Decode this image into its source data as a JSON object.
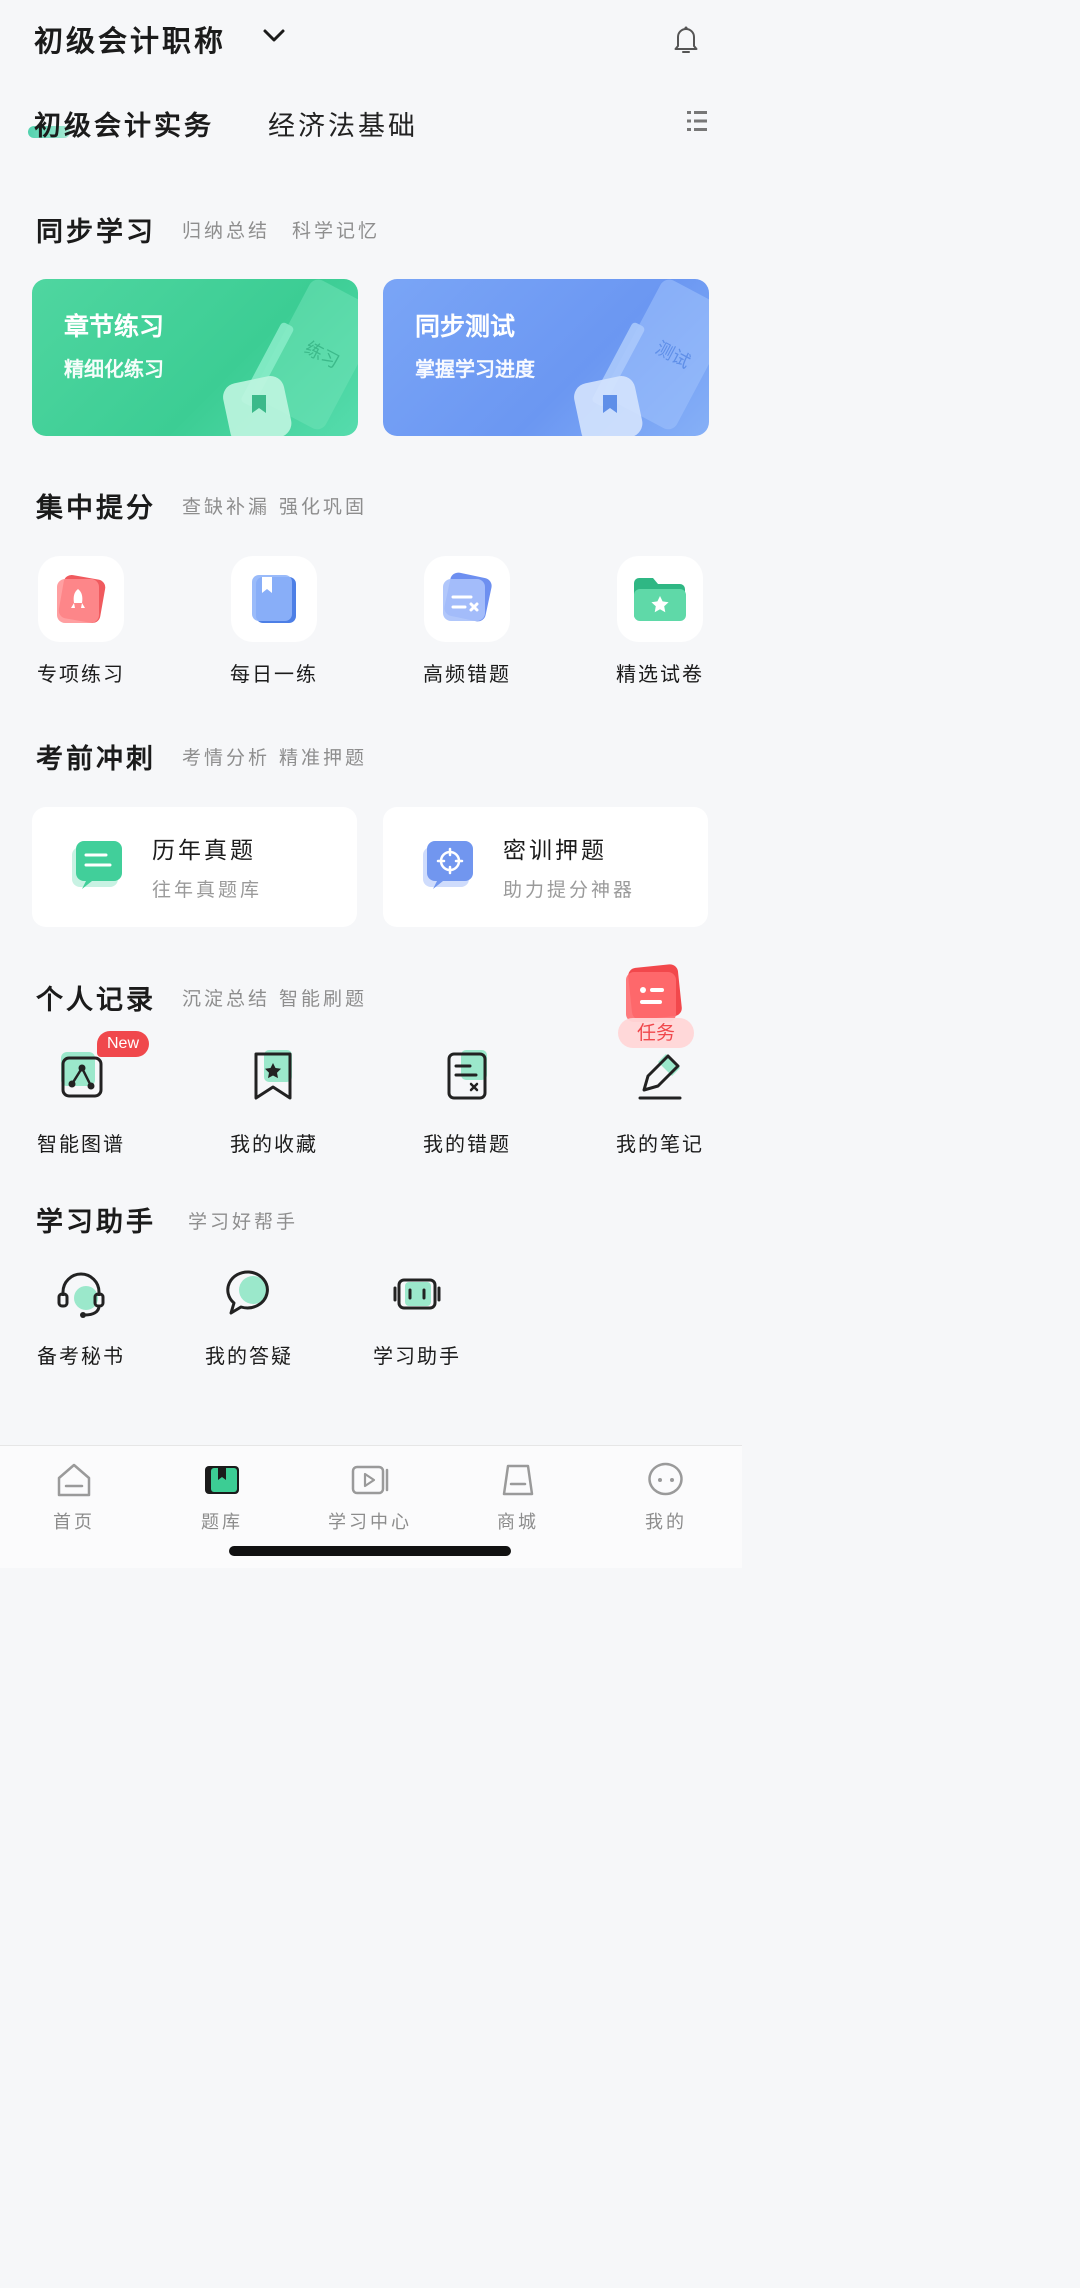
{
  "header": {
    "exam_title": "初级会计职称",
    "chevron_icon": "chevron-down-icon",
    "bell_icon": "bell-icon"
  },
  "subject_tabs": [
    {
      "label": "初级会计实务",
      "active": true
    },
    {
      "label": "经济法基础",
      "active": false
    }
  ],
  "sections": {
    "sync": {
      "title": "同步学习",
      "subtitle": "归纳总结　科学记忆"
    },
    "focus": {
      "title": "集中提分",
      "subtitle": "查缺补漏 强化巩固"
    },
    "sprint": {
      "title": "考前冲刺",
      "subtitle": "考情分析 精准押题"
    },
    "records": {
      "title": "个人记录",
      "subtitle": "沉淀总结 智能刷题"
    },
    "assistant": {
      "title": "学习助手",
      "subtitle": "学习好帮手"
    }
  },
  "sync_cards": [
    {
      "title": "章节练习",
      "subtitle": "精细化练习",
      "color": "#3ccd94"
    },
    {
      "title": "同步测试",
      "subtitle": "掌握学习进度",
      "color": "#6b97f2"
    }
  ],
  "focus_items": [
    {
      "label": "专项练习",
      "icon": "rocket-icon"
    },
    {
      "label": "每日一练",
      "icon": "book-icon"
    },
    {
      "label": "高频错题",
      "icon": "error-card-icon"
    },
    {
      "label": "精选试卷",
      "icon": "star-folder-icon"
    }
  ],
  "sprint_cards": [
    {
      "title": "历年真题",
      "subtitle": "往年真题库"
    },
    {
      "title": "密训押题",
      "subtitle": "助力提分神器"
    }
  ],
  "record_items": [
    {
      "label": "智能图谱",
      "icon": "knowledge-graph-icon"
    },
    {
      "label": "我的收藏",
      "icon": "bookmark-star-icon"
    },
    {
      "label": "我的错题",
      "icon": "error-sheet-icon"
    },
    {
      "label": "我的笔记",
      "icon": "pencil-note-icon"
    }
  ],
  "badges": {
    "new": "New",
    "task": "任务"
  },
  "assistant_items": [
    {
      "label": "备考秘书",
      "icon": "headset-icon"
    },
    {
      "label": "我的答疑",
      "icon": "chat-bubble-icon"
    },
    {
      "label": "学习助手",
      "icon": "robot-icon"
    }
  ],
  "bottom_nav": [
    {
      "label": "首页",
      "icon": "home-icon",
      "active": false
    },
    {
      "label": "题库",
      "icon": "question-bank-icon",
      "active": true
    },
    {
      "label": "学习中心",
      "icon": "play-video-icon",
      "active": false
    },
    {
      "label": "商城",
      "icon": "shopping-bag-icon",
      "active": false
    },
    {
      "label": "我的",
      "icon": "profile-face-icon",
      "active": false
    }
  ],
  "colors": {
    "accent_green": "#3ccd94",
    "accent_blue": "#6b97f2",
    "badge_red": "#f0484c"
  }
}
